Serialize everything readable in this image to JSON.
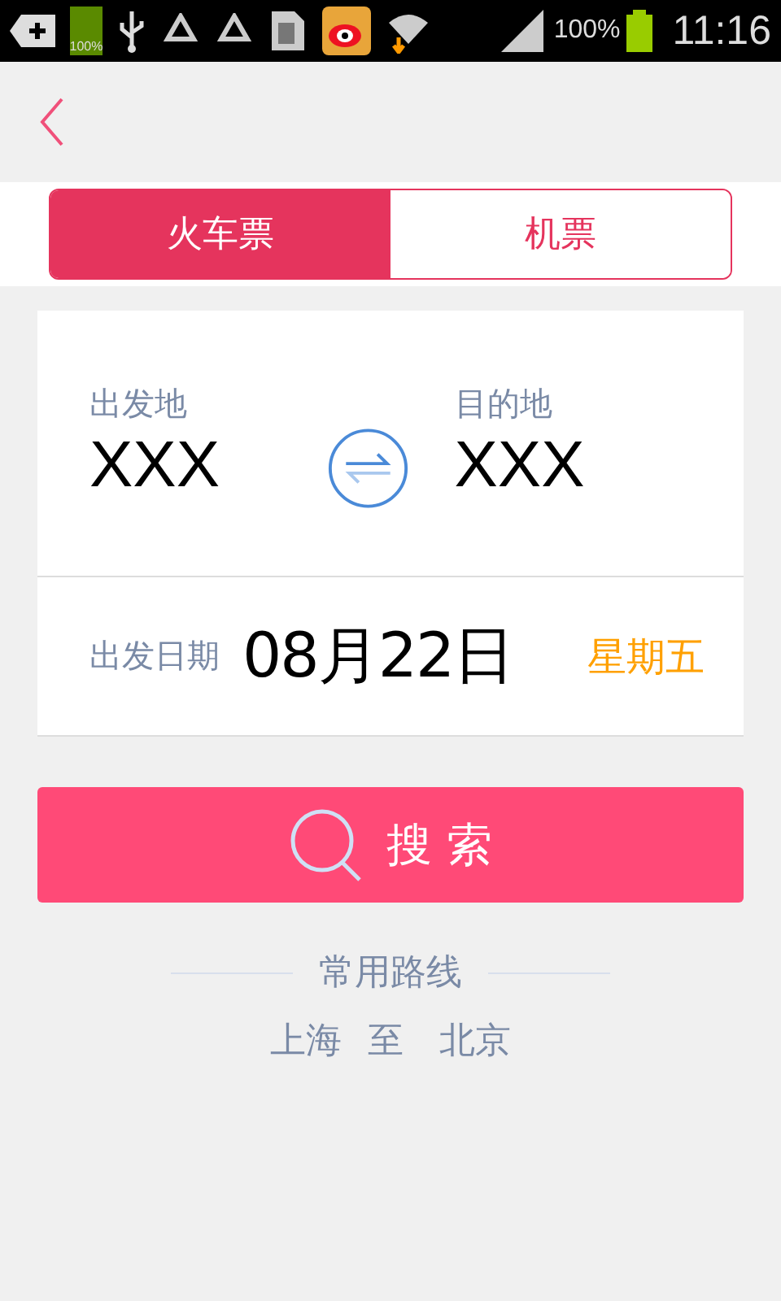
{
  "status_bar": {
    "battery_small_label": "100%",
    "battery_percent": "100%",
    "time": "11:16"
  },
  "tabs": [
    {
      "label": "火车票",
      "selected": true
    },
    {
      "label": "机票",
      "selected": false
    }
  ],
  "trip": {
    "origin": {
      "label": "出发地",
      "value": "XXX"
    },
    "destination": {
      "label": "目的地",
      "value": "XXX"
    }
  },
  "date": {
    "label": "出发日期",
    "value": "08月22日",
    "weekday": "星期五"
  },
  "search_button": {
    "label": "搜 索"
  },
  "frequent_routes": {
    "title": "常用路线",
    "routes": [
      {
        "from": "上海",
        "separator": "至",
        "to": "北京"
      }
    ]
  }
}
